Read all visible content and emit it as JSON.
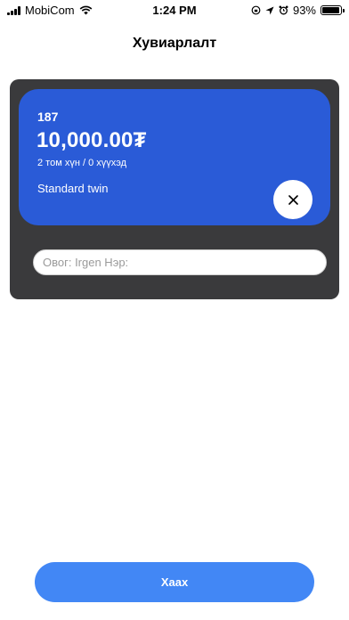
{
  "status_bar": {
    "carrier": "MobiCom",
    "time": "1:24 PM",
    "battery": "93%",
    "battery_level": 0.93
  },
  "header": {
    "title": "Хувиарлалт"
  },
  "room_card": {
    "number": "187",
    "price": "10,000.00₮",
    "guests": "2 том хүн / 0 хүүхэд",
    "room_type": "Standard twin",
    "close_icon": "close-icon"
  },
  "guest_form": {
    "name_placeholder": "Овог: Irgen Нэр:",
    "name_value": ""
  },
  "footer": {
    "close_label": "Хаах"
  },
  "colors": {
    "panel": "#3a3a3c",
    "card": "#2a5bd7",
    "primary_button": "#4287f5"
  }
}
